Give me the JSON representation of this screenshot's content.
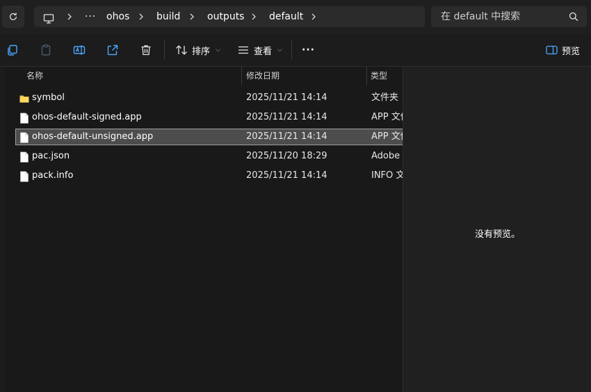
{
  "breadcrumb": {
    "overflow": "···",
    "segments": [
      "ohos",
      "build",
      "outputs",
      "default"
    ]
  },
  "search": {
    "placeholder": "在 default 中搜索"
  },
  "toolbar": {
    "sort_label": "排序",
    "view_label": "查看",
    "more_label": "···",
    "preview_label": "预览"
  },
  "columns": {
    "name": "名称",
    "date": "修改日期",
    "type": "类型"
  },
  "files": [
    {
      "name": "symbol",
      "date": "2025/11/21 14:14",
      "type": "文件夹",
      "kind": "folder"
    },
    {
      "name": "ohos-default-signed.app",
      "date": "2025/11/21 14:14",
      "type": "APP 文件",
      "kind": "file"
    },
    {
      "name": "ohos-default-unsigned.app",
      "date": "2025/11/21 14:14",
      "type": "APP 文件",
      "kind": "file",
      "selected": true
    },
    {
      "name": "pac.json",
      "date": "2025/11/20 18:29",
      "type": "Adobe After Effects",
      "kind": "file"
    },
    {
      "name": "pack.info",
      "date": "2025/11/21 14:14",
      "type": "INFO 文件",
      "kind": "file"
    }
  ],
  "preview": {
    "message": "没有预览。"
  },
  "colors": {
    "folder": "#f4c54a",
    "selection": "#4d4d4d",
    "background": "#191919"
  }
}
